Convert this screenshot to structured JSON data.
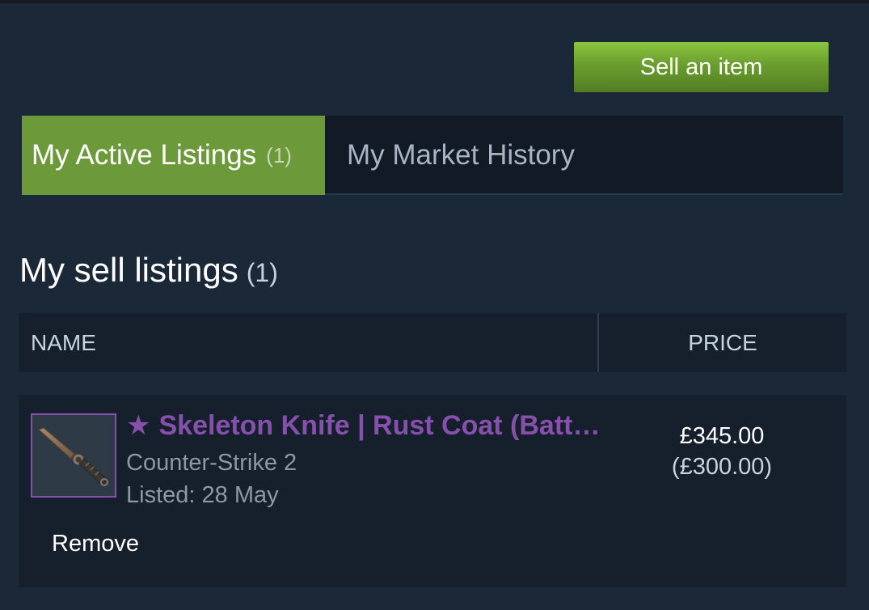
{
  "header": {
    "sell_button_label": "Sell an item"
  },
  "tabs": [
    {
      "label": "My Active Listings",
      "count": "(1)",
      "active": true
    },
    {
      "label": "My Market History",
      "active": false
    }
  ],
  "section": {
    "title": "My sell listings",
    "count": "(1)"
  },
  "table": {
    "columns": [
      "NAME",
      "PRICE"
    ],
    "rows": [
      {
        "star": "★",
        "name": "Skeleton Knife | Rust Coat (Battle-Scarred)",
        "game": "Counter-Strike 2",
        "listed": "Listed: 28 May",
        "price": "£345.00",
        "price_net": "(£300.00)",
        "action": "Remove",
        "icon": "knife-thumbnail-icon"
      }
    ]
  },
  "colors": {
    "background": "#1b2838",
    "accent_green": "#6c9a3a",
    "rarity_purple": "#8650ac"
  }
}
